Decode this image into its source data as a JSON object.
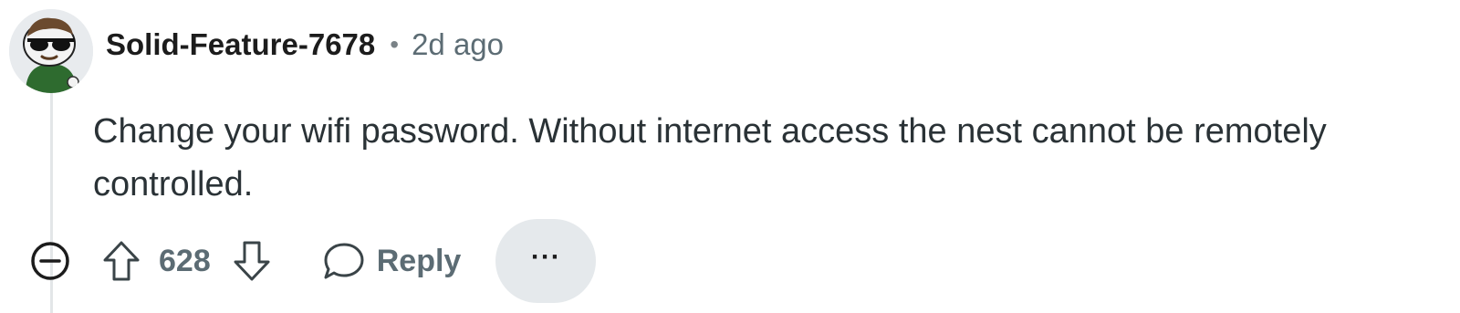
{
  "comment": {
    "author": "Solid-Feature-7678",
    "separator": "•",
    "timestamp": "2d ago",
    "body": "Change your wifi password. Without internet access the nest cannot be remotely controlled.",
    "score": "628",
    "reply_label": "Reply",
    "more_label": "···"
  },
  "icons": {
    "avatar": "snoo-avatar-sunglasses",
    "collapse": "collapse-minus-circle-icon",
    "upvote": "arrow-up-icon",
    "downvote": "arrow-down-icon",
    "reply": "speech-bubble-icon",
    "more": "ellipsis-icon"
  },
  "colors": {
    "text": "#1c1c1c",
    "muted": "#5c6c74",
    "thread_line": "#e3e6e8",
    "pill_bg": "#e5e9ec",
    "avatar_shirt": "#2e6b2f"
  }
}
